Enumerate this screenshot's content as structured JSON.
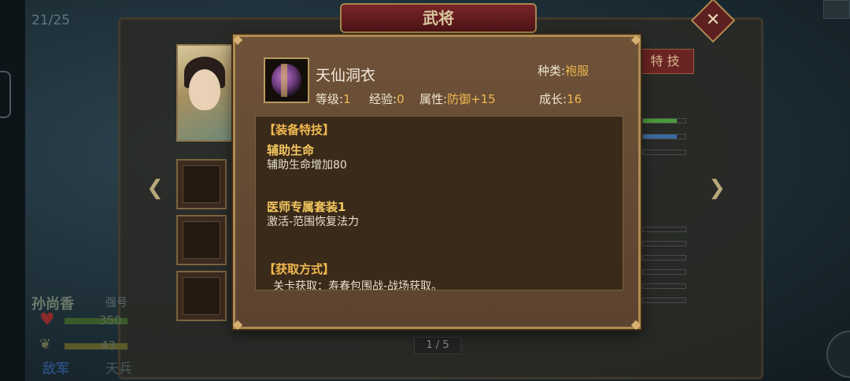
{
  "background": {
    "page_counter": "21/25",
    "title": "武将",
    "close_label": "✕",
    "skill_tab": "特 技",
    "hero_name": "孙尚香",
    "hero_level_label": "强号",
    "hp_value": "350",
    "mp_value": "43",
    "faction_label": "敌军",
    "other_label": "天兵",
    "pager": "1 / 5"
  },
  "popup": {
    "item_name": "天仙洞衣",
    "kind_label": "种类:",
    "kind_value": "袍服",
    "level_label": "等级:",
    "level_value": "1",
    "exp_label": "经验:",
    "exp_value": "0",
    "attr_label": "属性:",
    "attr_value": "防御+15",
    "growth_label": "成长:",
    "growth_value": "16",
    "equip_skill_header": "【装备特技】",
    "skills": [
      {
        "name": "辅助生命",
        "desc": "辅助生命增加80"
      },
      {
        "name": "医师专属套装1",
        "desc": "激活-范围恢复法力"
      }
    ],
    "acquire_header": "【获取方式】",
    "acquire_desc": "关卡获取：寿春包围战-战场获取。"
  },
  "icons": {
    "close": "close-icon",
    "left_arrow": "chevron-left-icon",
    "right_arrow": "chevron-right-icon",
    "heart": "heart-icon",
    "leaf": "leaf-icon",
    "item": "robe-item-icon"
  },
  "colors": {
    "popup_bg": "#6e5238",
    "popup_border": "#b08a52",
    "highlight": "#f0b850",
    "detail_bg": "#3a2a1a"
  }
}
